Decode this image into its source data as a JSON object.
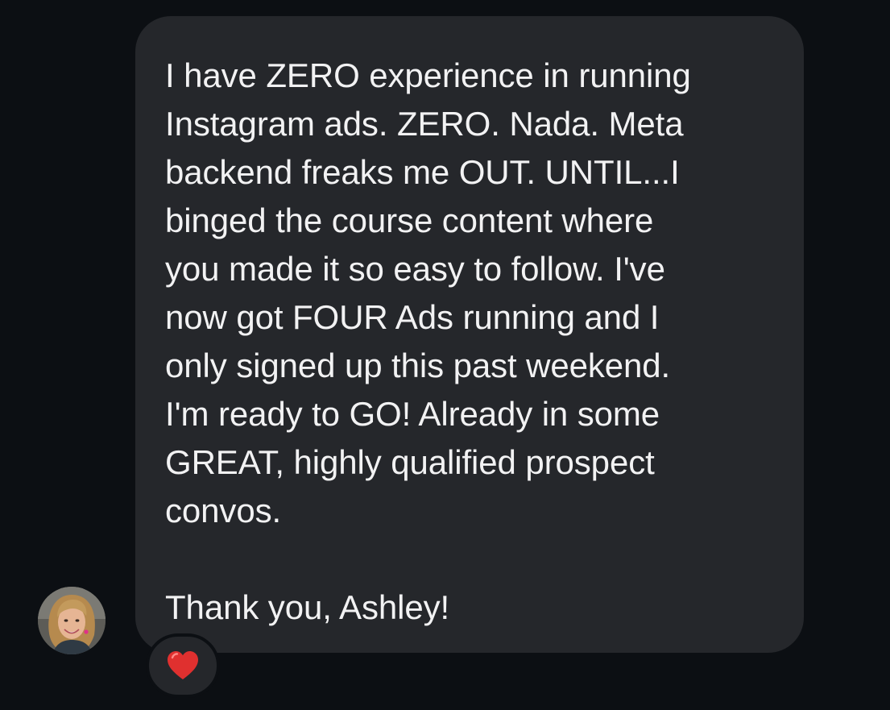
{
  "message": {
    "text": "I have ZERO experience in running\nInstagram ads. ZERO. Nada. Meta\nbackend freaks me OUT. UNTIL...I\nbinged the course content where\nyou made it so easy to follow. I've\nnow got FOUR Ads running and I\nonly signed up this past weekend.\nI'm ready to GO! Already in some\nGREAT, highly qualified prospect\nconvos.\n\nThank you, Ashley!"
  },
  "sender": {
    "avatar_icon": "profile-photo"
  },
  "reaction": {
    "icon": "red-heart-icon",
    "color": "#e0302f"
  },
  "colors": {
    "background": "#0c0f13",
    "bubble": "#25272b",
    "text": "#f2f2f3"
  }
}
